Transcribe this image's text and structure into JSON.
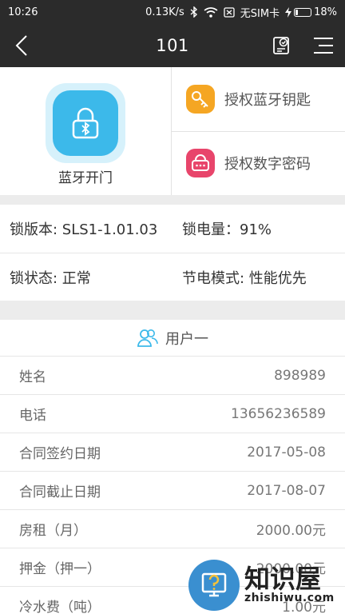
{
  "status_bar": {
    "time": "10:26",
    "net_speed": "0.13K/s",
    "sim": "无SIM卡",
    "battery": "18%",
    "battery_level": 0.18
  },
  "header": {
    "title": "101",
    "back_icon": "chevron-left-icon",
    "record_icon": "record-check-icon",
    "menu_icon": "menu-lines-icon"
  },
  "actions": {
    "bluetooth_open": "蓝牙开门",
    "auth_bt_key": "授权蓝牙钥匙",
    "auth_pin": "授权数字密码",
    "colors": {
      "bluetooth": "#3cb9ea",
      "key": "#f5a623",
      "pin": "#e8456b"
    }
  },
  "lock_info": {
    "version": "锁版本: SLS1-1.01.03",
    "battery": "锁电量：91%",
    "state": "锁状态: 正常",
    "power_mode": "节电模式: 性能优先"
  },
  "user": {
    "title": "用户一",
    "fields": [
      {
        "label": "姓名",
        "value": "898989"
      },
      {
        "label": "电话",
        "value": "13656236589"
      },
      {
        "label": "合同签约日期",
        "value": "2017-05-08"
      },
      {
        "label": "合同截止日期",
        "value": "2017-08-07"
      },
      {
        "label": "房租（月）",
        "value": "2000.00元"
      },
      {
        "label": "押金（押一）",
        "value": "2000.00元"
      },
      {
        "label": "冷水费（吨）",
        "value": "1.00元"
      }
    ]
  },
  "watermark": {
    "cn": "知识屋",
    "en": "zhishiwu.com"
  }
}
